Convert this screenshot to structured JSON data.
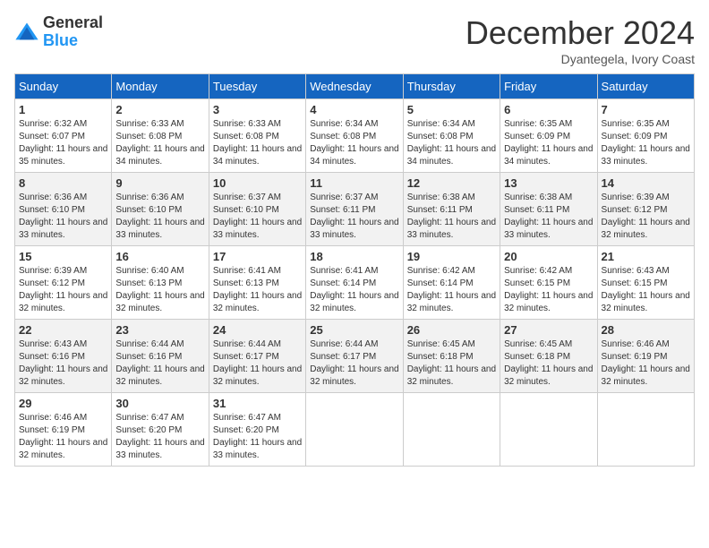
{
  "logo": {
    "general": "General",
    "blue": "Blue"
  },
  "title": "December 2024",
  "location": "Dyantegela, Ivory Coast",
  "days_of_week": [
    "Sunday",
    "Monday",
    "Tuesday",
    "Wednesday",
    "Thursday",
    "Friday",
    "Saturday"
  ],
  "weeks": [
    [
      {
        "day": "1",
        "sunrise": "6:32 AM",
        "sunset": "6:07 PM",
        "daylight": "11 hours and 35 minutes."
      },
      {
        "day": "2",
        "sunrise": "6:33 AM",
        "sunset": "6:08 PM",
        "daylight": "11 hours and 34 minutes."
      },
      {
        "day": "3",
        "sunrise": "6:33 AM",
        "sunset": "6:08 PM",
        "daylight": "11 hours and 34 minutes."
      },
      {
        "day": "4",
        "sunrise": "6:34 AM",
        "sunset": "6:08 PM",
        "daylight": "11 hours and 34 minutes."
      },
      {
        "day": "5",
        "sunrise": "6:34 AM",
        "sunset": "6:08 PM",
        "daylight": "11 hours and 34 minutes."
      },
      {
        "day": "6",
        "sunrise": "6:35 AM",
        "sunset": "6:09 PM",
        "daylight": "11 hours and 34 minutes."
      },
      {
        "day": "7",
        "sunrise": "6:35 AM",
        "sunset": "6:09 PM",
        "daylight": "11 hours and 33 minutes."
      }
    ],
    [
      {
        "day": "8",
        "sunrise": "6:36 AM",
        "sunset": "6:10 PM",
        "daylight": "11 hours and 33 minutes."
      },
      {
        "day": "9",
        "sunrise": "6:36 AM",
        "sunset": "6:10 PM",
        "daylight": "11 hours and 33 minutes."
      },
      {
        "day": "10",
        "sunrise": "6:37 AM",
        "sunset": "6:10 PM",
        "daylight": "11 hours and 33 minutes."
      },
      {
        "day": "11",
        "sunrise": "6:37 AM",
        "sunset": "6:11 PM",
        "daylight": "11 hours and 33 minutes."
      },
      {
        "day": "12",
        "sunrise": "6:38 AM",
        "sunset": "6:11 PM",
        "daylight": "11 hours and 33 minutes."
      },
      {
        "day": "13",
        "sunrise": "6:38 AM",
        "sunset": "6:11 PM",
        "daylight": "11 hours and 33 minutes."
      },
      {
        "day": "14",
        "sunrise": "6:39 AM",
        "sunset": "6:12 PM",
        "daylight": "11 hours and 32 minutes."
      }
    ],
    [
      {
        "day": "15",
        "sunrise": "6:39 AM",
        "sunset": "6:12 PM",
        "daylight": "11 hours and 32 minutes."
      },
      {
        "day": "16",
        "sunrise": "6:40 AM",
        "sunset": "6:13 PM",
        "daylight": "11 hours and 32 minutes."
      },
      {
        "day": "17",
        "sunrise": "6:41 AM",
        "sunset": "6:13 PM",
        "daylight": "11 hours and 32 minutes."
      },
      {
        "day": "18",
        "sunrise": "6:41 AM",
        "sunset": "6:14 PM",
        "daylight": "11 hours and 32 minutes."
      },
      {
        "day": "19",
        "sunrise": "6:42 AM",
        "sunset": "6:14 PM",
        "daylight": "11 hours and 32 minutes."
      },
      {
        "day": "20",
        "sunrise": "6:42 AM",
        "sunset": "6:15 PM",
        "daylight": "11 hours and 32 minutes."
      },
      {
        "day": "21",
        "sunrise": "6:43 AM",
        "sunset": "6:15 PM",
        "daylight": "11 hours and 32 minutes."
      }
    ],
    [
      {
        "day": "22",
        "sunrise": "6:43 AM",
        "sunset": "6:16 PM",
        "daylight": "11 hours and 32 minutes."
      },
      {
        "day": "23",
        "sunrise": "6:44 AM",
        "sunset": "6:16 PM",
        "daylight": "11 hours and 32 minutes."
      },
      {
        "day": "24",
        "sunrise": "6:44 AM",
        "sunset": "6:17 PM",
        "daylight": "11 hours and 32 minutes."
      },
      {
        "day": "25",
        "sunrise": "6:44 AM",
        "sunset": "6:17 PM",
        "daylight": "11 hours and 32 minutes."
      },
      {
        "day": "26",
        "sunrise": "6:45 AM",
        "sunset": "6:18 PM",
        "daylight": "11 hours and 32 minutes."
      },
      {
        "day": "27",
        "sunrise": "6:45 AM",
        "sunset": "6:18 PM",
        "daylight": "11 hours and 32 minutes."
      },
      {
        "day": "28",
        "sunrise": "6:46 AM",
        "sunset": "6:19 PM",
        "daylight": "11 hours and 32 minutes."
      }
    ],
    [
      {
        "day": "29",
        "sunrise": "6:46 AM",
        "sunset": "6:19 PM",
        "daylight": "11 hours and 32 minutes."
      },
      {
        "day": "30",
        "sunrise": "6:47 AM",
        "sunset": "6:20 PM",
        "daylight": "11 hours and 33 minutes."
      },
      {
        "day": "31",
        "sunrise": "6:47 AM",
        "sunset": "6:20 PM",
        "daylight": "11 hours and 33 minutes."
      },
      null,
      null,
      null,
      null
    ]
  ]
}
